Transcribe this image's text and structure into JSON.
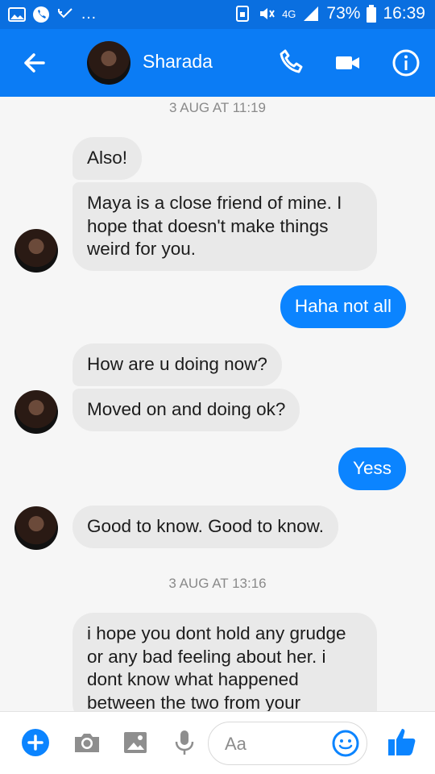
{
  "status_bar": {
    "network": "4G",
    "battery": "73%",
    "time": "16:39",
    "notifications": [
      "image-icon",
      "phone-icon",
      "missed-call-icon",
      "more-icon"
    ]
  },
  "header": {
    "contact_name": "Sharada",
    "accent_color": "#0b7cf5"
  },
  "conversation": {
    "timestamps": [
      "3 AUG AT 11:19",
      "3 AUG AT 13:16"
    ],
    "messages": [
      {
        "from": "contact",
        "text": "Also!"
      },
      {
        "from": "contact",
        "text": "Maya is a close friend of mine. I hope that doesn't make things weird for you."
      },
      {
        "from": "me",
        "text": "Haha not all"
      },
      {
        "from": "contact",
        "text": "How are u doing now?"
      },
      {
        "from": "contact",
        "text": "Moved on and doing ok?"
      },
      {
        "from": "me",
        "text": "Yess"
      },
      {
        "from": "contact",
        "text": "Good to know. Good to know."
      },
      {
        "from": "contact",
        "text": "i hope you dont hold any grudge or any bad feeling about her. i dont know what happened between the two from your"
      }
    ]
  },
  "composer": {
    "placeholder": "Aa"
  }
}
